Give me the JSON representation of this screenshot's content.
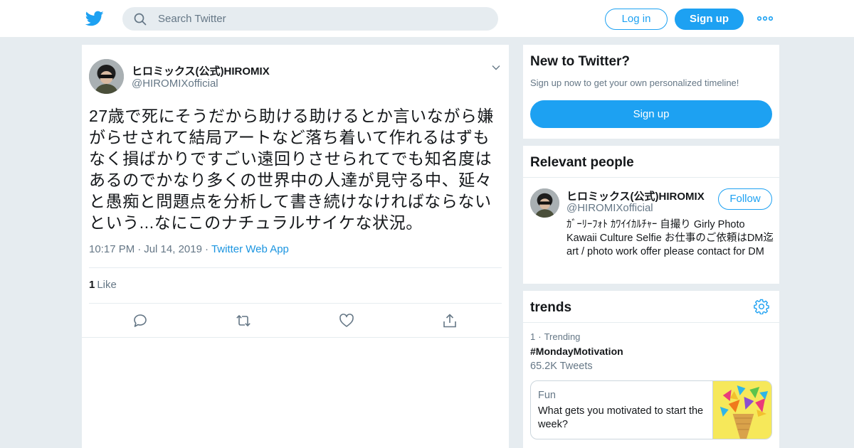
{
  "header": {
    "search": {
      "placeholder": "Search Twitter"
    },
    "login_label": "Log in",
    "signup_label": "Sign up",
    "brand_color": "#1da1f2"
  },
  "tweet": {
    "author": {
      "display_name": "ヒロミックス(公式)HIROMIX",
      "screen_name": "@HIROMIXofficial"
    },
    "text": "27歳で死にそうだから助ける助けるとか言いながら嫌がらせされて結局アートなど落ち着いて作れるはずもなく損ばかりですごい遠回りさせられてでも知名度はあるのでかなり多くの世界中の人達が見守る中、延々と愚痴と問題点を分析して書き続けなければならないという...なにこのナチュラルサイケな状況。",
    "time": "10:17 PM",
    "date": "Jul 14, 2019",
    "source": "Twitter Web App",
    "likes_count": "1",
    "likes_label": "Like",
    "actions": [
      "reply-icon",
      "retweet-icon",
      "like-icon",
      "share-icon"
    ]
  },
  "sidebar": {
    "signup_module": {
      "title": "New to Twitter?",
      "description": "Sign up now to get your own personalized timeline!",
      "button_label": "Sign up"
    },
    "relevant_people": {
      "title": "Relevant people",
      "person": {
        "display_name": "ヒロミックス(公式)HIROMIX",
        "screen_name": "@HIROMIXofficial",
        "follow_label": "Follow",
        "bio": "ｶﾞｰﾘｰﾌｫﾄ ｶﾜｲｲｶﾙﾁｬｰ 自撮り Girly Photo Kawaii Culture Selfie お仕事のご依頼はDM迄 art / photo work offer please contact for DM"
      }
    },
    "trends": {
      "title": "trends",
      "items": [
        {
          "rank": "1",
          "context": "Trending",
          "name": "#MondayMotivation",
          "count": "65.2K Tweets"
        }
      ],
      "event": {
        "category": "Fun",
        "title": "What gets you motivated to start the week?"
      }
    }
  }
}
